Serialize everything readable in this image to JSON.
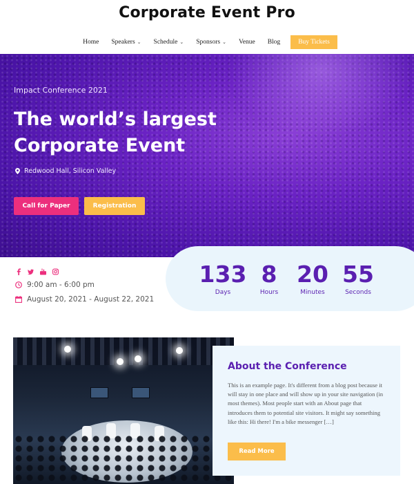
{
  "header": {
    "brand": "Corporate Event Pro",
    "nav": [
      {
        "label": "Home",
        "dropdown": false
      },
      {
        "label": "Speakers",
        "dropdown": true
      },
      {
        "label": "Schedule",
        "dropdown": true
      },
      {
        "label": "Sponsors",
        "dropdown": true
      },
      {
        "label": "Venue",
        "dropdown": false
      },
      {
        "label": "Blog",
        "dropdown": false
      }
    ],
    "cta_label": "Buy Tickets"
  },
  "hero": {
    "subtitle": "Impact Conference 2021",
    "title": "The world’s largest Corporate Event",
    "location": "Redwood Hall, Silicon Valley",
    "primary_button": "Call for Paper",
    "secondary_button": "Registration"
  },
  "info": {
    "social_icons": [
      "facebook-icon",
      "twitter-icon",
      "youtube-icon",
      "instagram-icon"
    ],
    "time": "9:00 am - 6:00 pm",
    "dates": "August 20, 2021 - August 22, 2021"
  },
  "countdown": [
    {
      "value": "133",
      "label": "Days"
    },
    {
      "value": "8",
      "label": "Hours"
    },
    {
      "value": "20",
      "label": "Minutes"
    },
    {
      "value": "55",
      "label": "Seconds"
    }
  ],
  "about": {
    "title": "About the Conference",
    "text": "This is an example page. It's different from a blog post because it will stay in one place and will show up in your site navigation (in most themes). Most people start with an About page that introduces them to potential site visitors. It might say something like this: Hi there! I'm a bike messenger […]",
    "button": "Read More"
  },
  "colors": {
    "purple": "#5a1fb0",
    "pink": "#ec2f7d",
    "yellow": "#fbbd4a",
    "light_blue": "#eaf5fc"
  }
}
